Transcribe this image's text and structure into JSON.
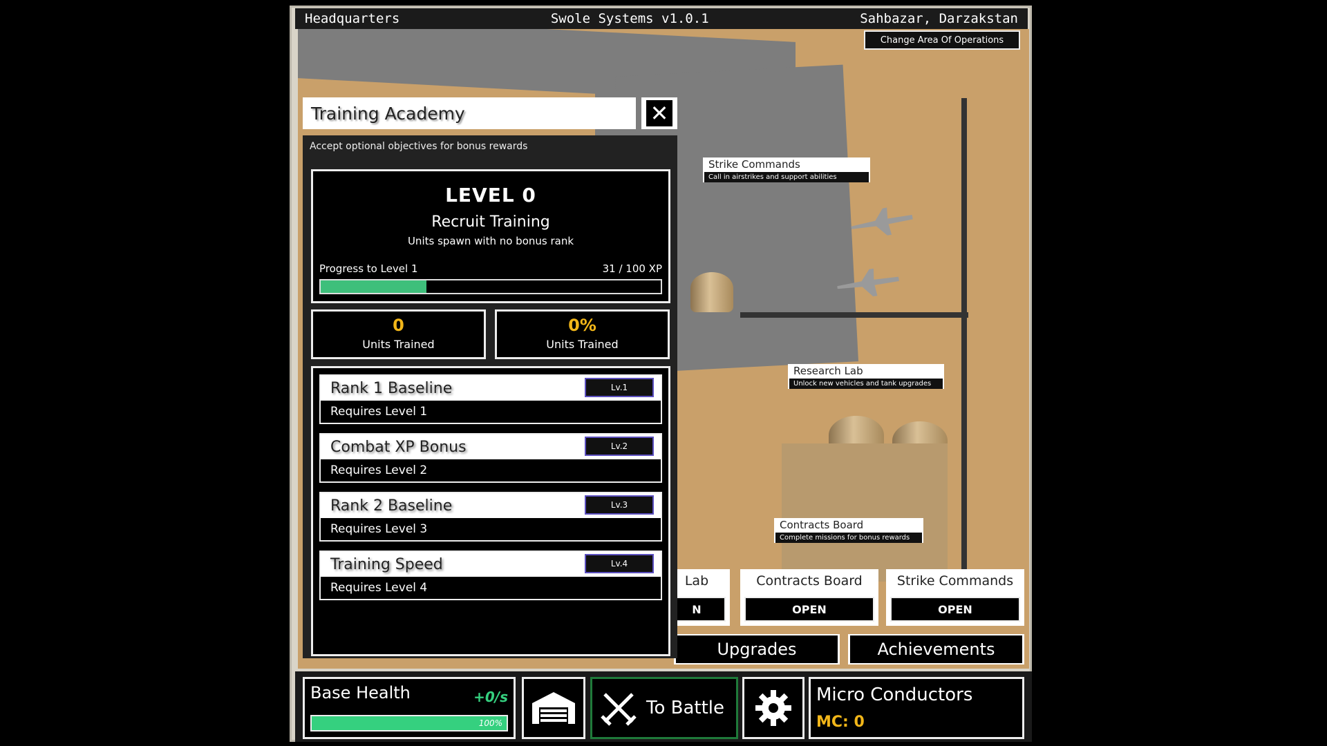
{
  "topbar": {
    "left": "Headquarters",
    "center": "Swole Systems v1.0.1",
    "right": "Sahbazar, Darzakstan"
  },
  "change_area_label": "Change Area Of Operations",
  "map_labels": {
    "strike": {
      "title": "Strike Commands",
      "sub": "Call in airstrikes and support abilities"
    },
    "research": {
      "title": "Research Lab",
      "sub": "Unlock new vehicles and tank upgrades"
    },
    "contracts": {
      "title": "Contracts Board",
      "sub": "Complete missions for bonus rewards"
    }
  },
  "panel": {
    "title": "Training Academy",
    "subtitle": "Accept optional objectives for bonus rewards",
    "level_title": "LEVEL 0",
    "level_name": "Recruit Training",
    "level_desc": "Units spawn with no bonus rank",
    "progress_label": "Progress to Level 1",
    "progress_value": "31 / 100 XP",
    "progress_fraction": 0.31,
    "stats": [
      {
        "value": "0",
        "label": "Units Trained"
      },
      {
        "value": "0%",
        "label": "Units Trained"
      }
    ],
    "upgrades": [
      {
        "name": "Rank 1 Baseline",
        "level": "Lv.1",
        "requirement": "Requires Level 1"
      },
      {
        "name": "Combat XP Bonus",
        "level": "Lv.2",
        "requirement": "Requires Level 2"
      },
      {
        "name": "Rank 2 Baseline",
        "level": "Lv.3",
        "requirement": "Requires Level 3"
      },
      {
        "name": "Training Speed",
        "level": "Lv.4",
        "requirement": "Requires Level 4"
      }
    ]
  },
  "facilities": [
    {
      "title": "Lab",
      "button": "N"
    },
    {
      "title": "Contracts Board",
      "button": "OPEN"
    },
    {
      "title": "Strike Commands",
      "button": "OPEN"
    }
  ],
  "buttons": {
    "upgrades": "Upgrades",
    "achievements": "Achievements"
  },
  "hud": {
    "base_health_label": "Base Health",
    "base_health_rate": "+0/s",
    "base_health_value": "100%",
    "base_health_fraction": 1.0,
    "battle_label": "To Battle",
    "currency_title": "Micro Conductors",
    "currency_value": "MC: 0"
  },
  "colors": {
    "accent_green": "#3ebf7b",
    "gold": "#f2b619",
    "level_badge_border": "#5b4fbf"
  }
}
